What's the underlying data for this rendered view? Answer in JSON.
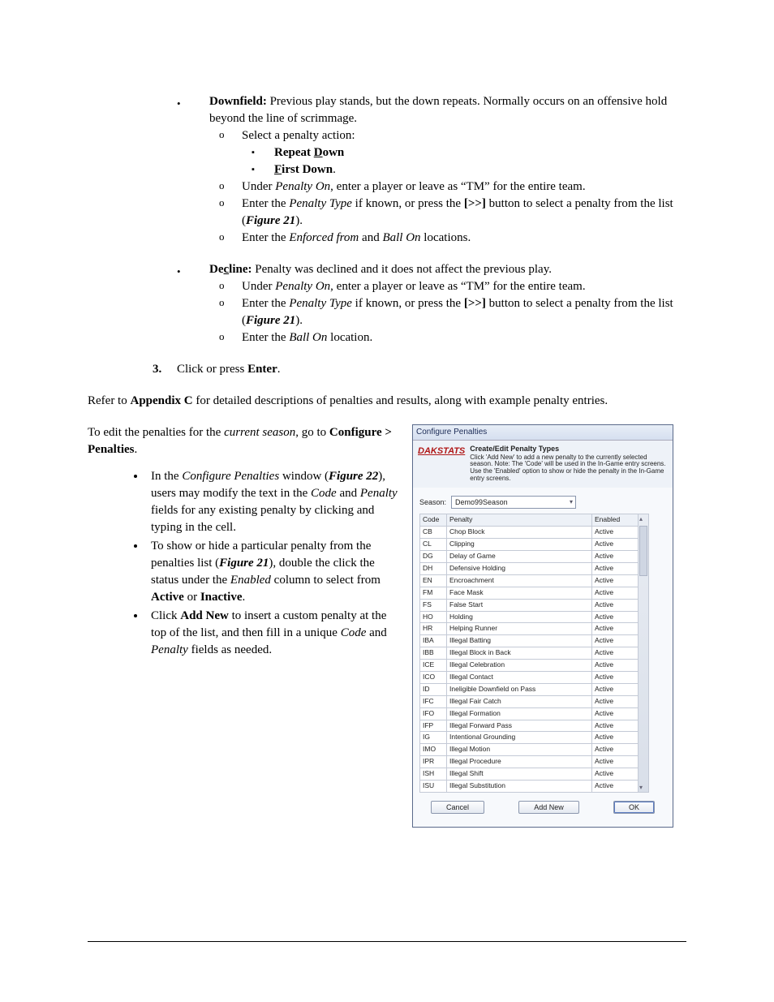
{
  "sections": {
    "downfield": {
      "label": "Downfield:",
      "desc": " Previous play stands, but the down repeats. Normally occurs on an offensive hold beyond the line of scrimmage.",
      "sub1": "Select a penalty action:",
      "opt1": "Repeat Down",
      "opt2": "First Down",
      "sub2_pre": "Under ",
      "sub2_i": "Penalty On",
      "sub2_post": ", enter a player or leave as “TM” for the entire team.",
      "sub3_pre": "Enter the ",
      "sub3_i": "Penalty Type",
      "sub3_mid": " if known, or press the ",
      "sub3_btn": "[>>]",
      "sub3_post": " button to select a penalty from the list (",
      "sub3_fig": "Figure 21",
      "sub3_end": ").",
      "sub4_pre": "Enter the ",
      "sub4_i1": "Enforced from",
      "sub4_and": " and ",
      "sub4_i2": "Ball On",
      "sub4_post": " locations."
    },
    "decline": {
      "label": "Decline:",
      "desc": " Penalty was declined and it does not affect the previous play.",
      "sub1_pre": "Under ",
      "sub1_i": "Penalty On",
      "sub1_post": ", enter a player or leave as “TM” for the entire team.",
      "sub2_pre": "Enter the ",
      "sub2_i": "Penalty Type",
      "sub2_mid": " if known, or press the ",
      "sub2_btn": "[>>]",
      "sub2_post": " button to select a penalty from the list (",
      "sub2_fig": "Figure 21",
      "sub2_end": ").",
      "sub3_pre": "Enter the ",
      "sub3_i": "Ball On",
      "sub3_post": " location."
    },
    "step3": {
      "num": "3.",
      "pre": "Click or press ",
      "b": "Enter",
      "post": "."
    },
    "refer": {
      "pre": "Refer to ",
      "b": "Appendix C",
      "post": " for detailed descriptions of penalties and results, along with example penalty entries."
    },
    "edit": {
      "intro_pre": "To edit the penalties for the ",
      "intro_i": "current season",
      "intro_mid": ", go to ",
      "intro_b": "Configure > Penalties",
      "intro_post": ".",
      "b1_pre": "In the ",
      "b1_i": "Configure Penalties",
      "b1_mid": " window (",
      "b1_fig": "Figure 22",
      "b1_mid2": "), users may modify the text in the ",
      "b1_i2": "Code",
      "b1_and": " and ",
      "b1_i3": "Penalty",
      "b1_post": " fields for any existing penalty by clicking and typing in the cell.",
      "b2_pre": "To show or hide a particular penalty from the penalties list (",
      "b2_fig": "Figure 21",
      "b2_mid": "), double the click the status under the ",
      "b2_i": "Enabled",
      "b2_mid2": " column to select from ",
      "b2_b1": "Active",
      "b2_or": " or ",
      "b2_b2": "Inactive",
      "b2_post": ".",
      "b3_pre": "Click ",
      "b3_b": "Add New",
      "b3_mid": " to insert a custom penalty at the top of the list, and then fill in a unique ",
      "b3_i1": "Code",
      "b3_and": " and ",
      "b3_i2": "Penalty",
      "b3_post": " fields as needed."
    }
  },
  "dialog": {
    "title": "Configure Penalties",
    "logo": "DAKSTATS",
    "subtitle": "Create/Edit Penalty Types",
    "note": "Click 'Add New' to add a new penalty to the currently selected season. Note: The 'Code' will be used in the In-Game entry screens. Use the 'Enabled' option to show or hide the penalty in the In-Game entry screens.",
    "season_label": "Season:",
    "season_value": "Demo99Season",
    "headers": {
      "code": "Code",
      "penalty": "Penalty",
      "enabled": "Enabled"
    },
    "rows": [
      {
        "code": "CB",
        "penalty": "Chop Block",
        "enabled": "Active"
      },
      {
        "code": "CL",
        "penalty": "Clipping",
        "enabled": "Active"
      },
      {
        "code": "DG",
        "penalty": "Delay of Game",
        "enabled": "Active"
      },
      {
        "code": "DH",
        "penalty": "Defensive Holding",
        "enabled": "Active"
      },
      {
        "code": "EN",
        "penalty": "Encroachment",
        "enabled": "Active"
      },
      {
        "code": "FM",
        "penalty": "Face Mask",
        "enabled": "Active"
      },
      {
        "code": "FS",
        "penalty": "False Start",
        "enabled": "Active"
      },
      {
        "code": "HO",
        "penalty": "Holding",
        "enabled": "Active"
      },
      {
        "code": "HR",
        "penalty": "Helping Runner",
        "enabled": "Active"
      },
      {
        "code": "IBA",
        "penalty": "Illegal Batting",
        "enabled": "Active"
      },
      {
        "code": "IBB",
        "penalty": "Illegal Block in Back",
        "enabled": "Active"
      },
      {
        "code": "ICE",
        "penalty": "Illegal Celebration",
        "enabled": "Active"
      },
      {
        "code": "ICO",
        "penalty": "Illegal Contact",
        "enabled": "Active"
      },
      {
        "code": "ID",
        "penalty": "Ineligible Downfield on Pass",
        "enabled": "Active"
      },
      {
        "code": "IFC",
        "penalty": "Illegal Fair Catch",
        "enabled": "Active"
      },
      {
        "code": "IFO",
        "penalty": "Illegal Formation",
        "enabled": "Active"
      },
      {
        "code": "IFP",
        "penalty": "Illegal Forward Pass",
        "enabled": "Active"
      },
      {
        "code": "IG",
        "penalty": "Intentional Grounding",
        "enabled": "Active"
      },
      {
        "code": "IMO",
        "penalty": "Illegal Motion",
        "enabled": "Active"
      },
      {
        "code": "IPR",
        "penalty": "Illegal Procedure",
        "enabled": "Active"
      },
      {
        "code": "ISH",
        "penalty": "Illegal Shift",
        "enabled": "Active"
      },
      {
        "code": "ISU",
        "penalty": "Illegal Substitution",
        "enabled": "Active"
      }
    ],
    "buttons": {
      "cancel": "Cancel",
      "addnew": "Add New",
      "ok": "OK"
    }
  }
}
